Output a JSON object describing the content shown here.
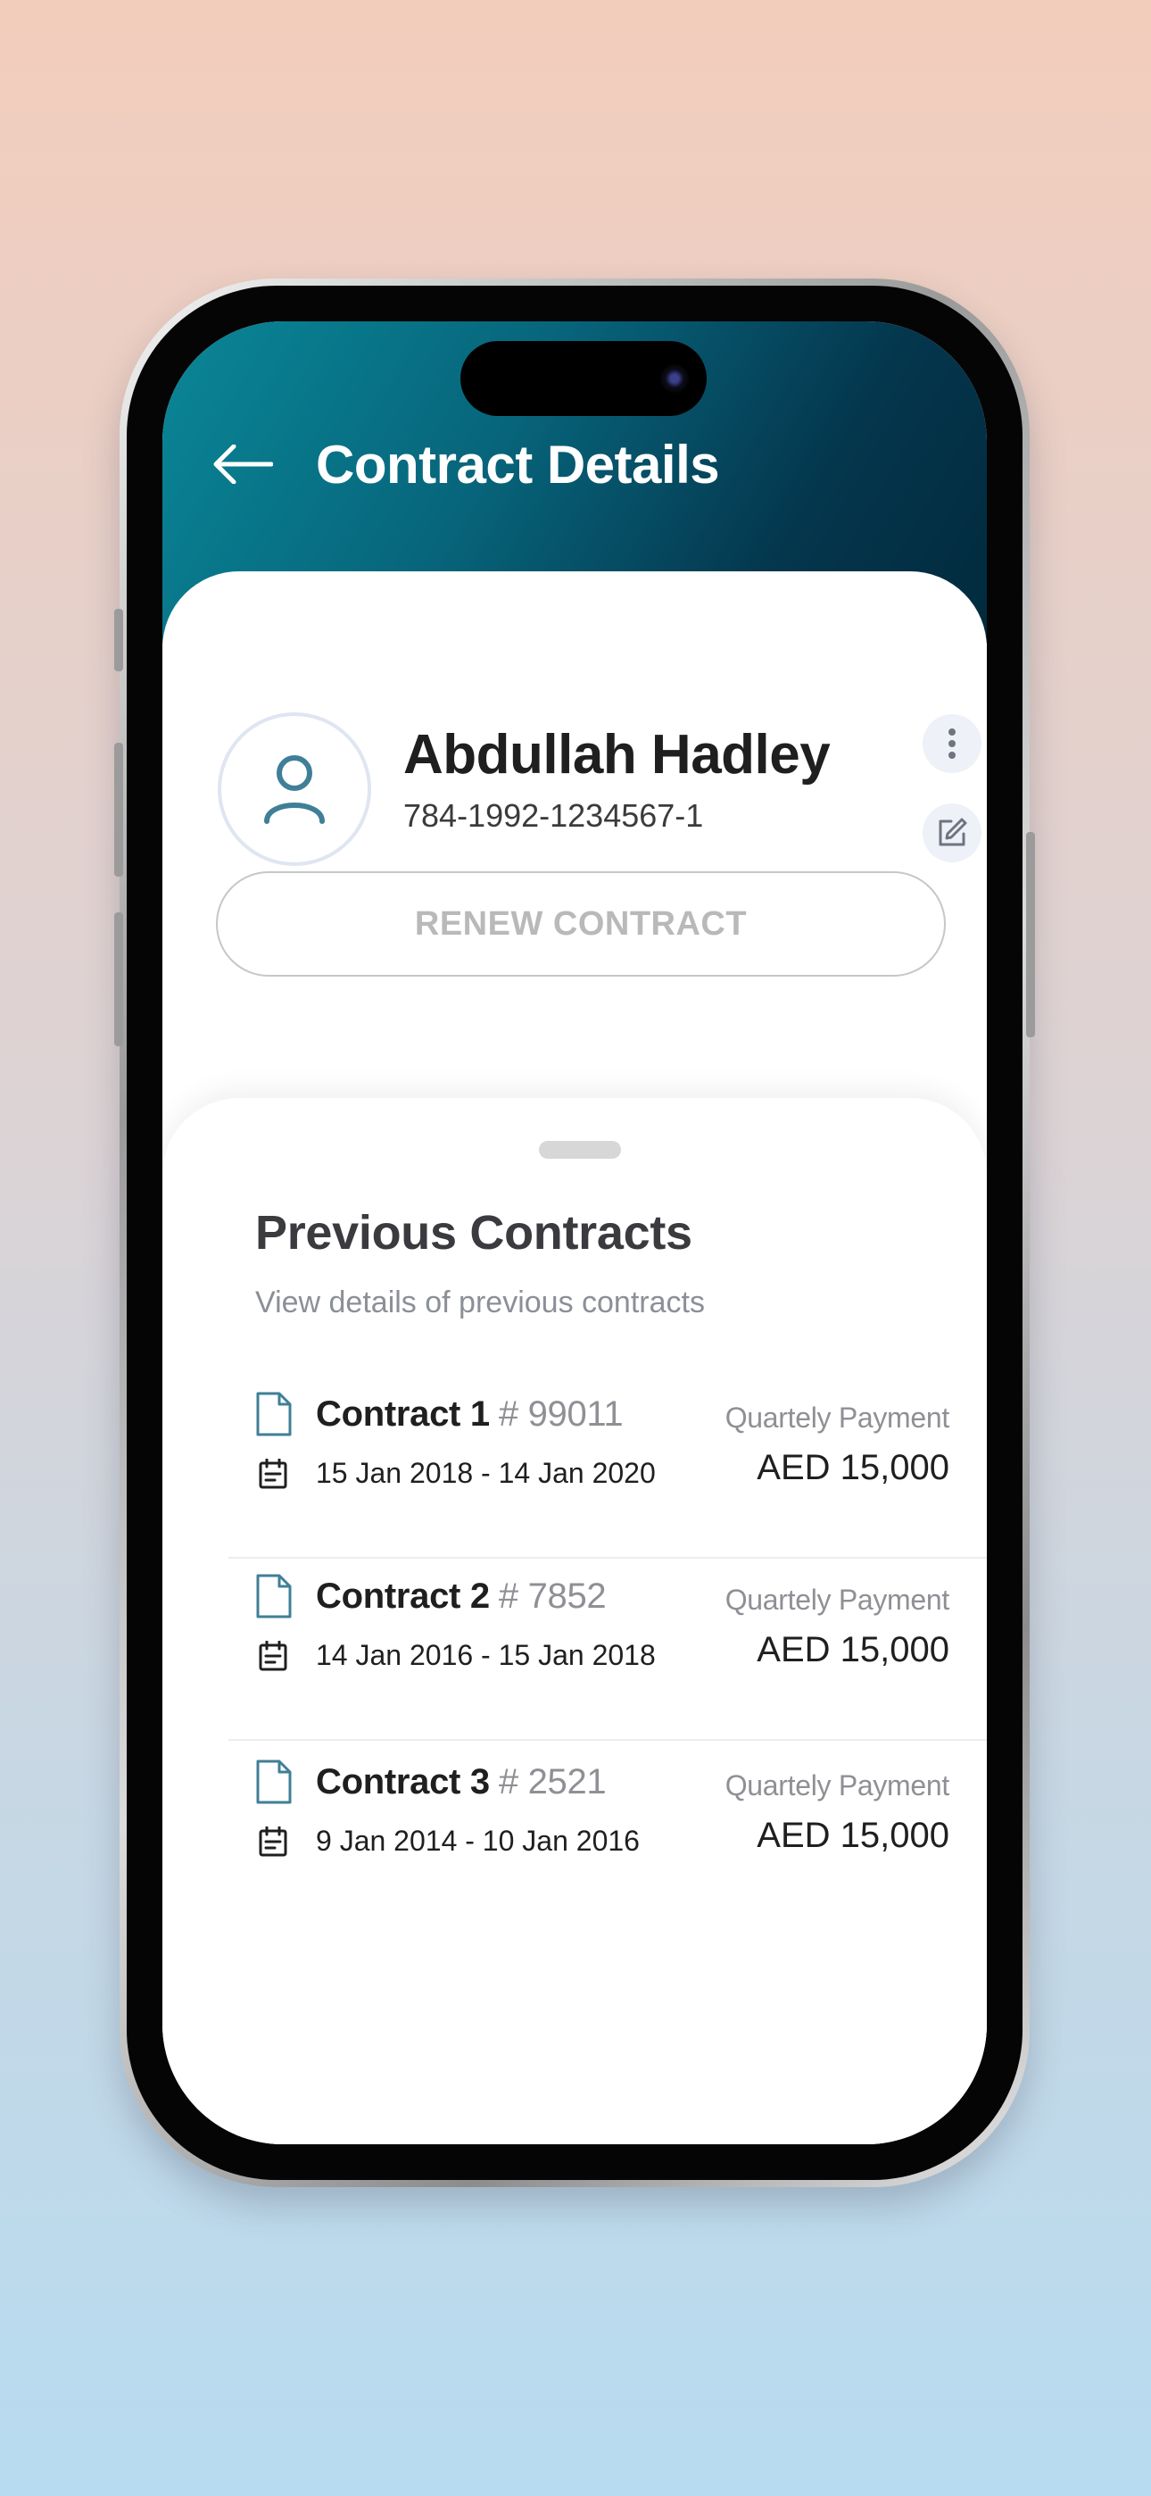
{
  "header": {
    "title": "Contract Details"
  },
  "profile": {
    "name": "Abdullah Hadley",
    "id_number": "784-1992-1234567-1"
  },
  "actions": {
    "renew_label": "RENEW CONTRACT"
  },
  "previous": {
    "title": "Previous Contracts",
    "subtitle": "View details of previous contracts",
    "contracts": [
      {
        "name": "Contract 1",
        "number": "# 99011",
        "dates": "15 Jan 2018  - 14 Jan 2020",
        "payment_label": "Quartely Payment",
        "amount": "AED 15,000"
      },
      {
        "name": "Contract 2",
        "number": "# 7852",
        "dates": "14 Jan 2016  - 15 Jan 2018",
        "payment_label": "Quartely Payment",
        "amount": "AED 15,000"
      },
      {
        "name": "Contract 3",
        "number": "# 2521",
        "dates": "9 Jan 2014  - 10 Jan 2016",
        "payment_label": "Quartely Payment",
        "amount": "AED 15,000"
      }
    ]
  },
  "colors": {
    "header_gradient_start": "#0a8798",
    "header_gradient_end": "#022a3d",
    "icon_teal": "#3f7f97"
  },
  "icons": [
    "arrow-left-icon",
    "user-icon",
    "more-vertical-icon",
    "edit-icon",
    "document-icon",
    "calendar-icon"
  ]
}
